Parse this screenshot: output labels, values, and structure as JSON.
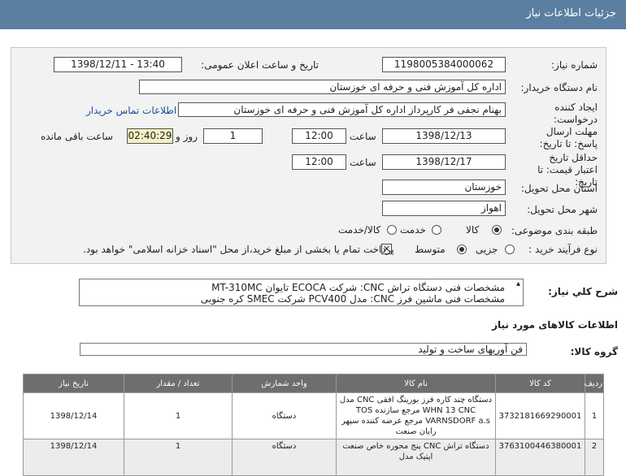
{
  "header": {
    "title": "جزئیات اطلاعات نیاز"
  },
  "fields": {
    "need_number_label": "شماره نیاز:",
    "need_number": "1198005384000062",
    "announce_label": "تاریخ و ساعت اعلان عمومی:",
    "announce_value": "1398/12/11 - 13:40",
    "buyer_label": "نام دستگاه خریدار:",
    "buyer_value": "اداره کل آموزش فنی و حرفه ای خوزستان",
    "creator_label": "ایجاد کننده درخواست:",
    "creator_value": "بهنام  نجفی فر  کارپرداز اداره کل آموزش فنی و حرفه ای خوزستان",
    "contact_link": "اطلاعات تماس خریدار",
    "deadline_label": "مهلت ارسال پاسخ: تا تاریخ:",
    "deadline_date": "1398/12/13",
    "time_label": "ساعت",
    "deadline_time": "12:00",
    "days_value": "1",
    "days_label": "روز و",
    "remaining_value": "02:40:29",
    "remaining_label": "ساعت باقی مانده",
    "validity_label": "حداقل تاریخ اعتبار قیمت: تا تاریخ:",
    "validity_date": "1398/12/17",
    "validity_time": "12:00",
    "province_label": "استان محل تحویل:",
    "province_value": "خوزستان",
    "city_label": "شهر محل تحویل:",
    "city_value": "اهواز",
    "category_label": "طبقه بندی موضوعی:",
    "category_options": [
      "کالا",
      "خدمت",
      "کالا/خدمت"
    ],
    "process_label": "نوع فرآیند خرید :",
    "process_options": [
      "جزیی",
      "متوسط"
    ],
    "payment_note": "پرداخت تمام یا بخشی از مبلغ خرید،از محل \"اسناد خزانه اسلامی\" خواهد بود."
  },
  "summary": {
    "label": "شرح کلي نياز:",
    "line1": "مشخصات فنی دستگاه تراش CNC: شرکت ECOCA تایوان MT-310MC",
    "line2": "مشخصات فنی ماشین فرز CNC: مدل PCV400 شرکت SMEC کره جنوبی"
  },
  "goods": {
    "section_title": "اطلاعات کالاهای مورد نیاز",
    "group_label": "گروه کالا:",
    "group_value": "فن آوریهای ساخت و تولید"
  },
  "table": {
    "headers": [
      "ردیف",
      "کد کالا",
      "نام کالا",
      "واحد شمارش",
      "تعداد / مقدار",
      "تاریخ نیاز"
    ],
    "rows": [
      [
        "1",
        "3732181669290001",
        "دستگاه چند کاره فرز بورینگ افقی CNC مدل WHN 13 CNC مرجع سازنده TOS VARNSDORF a.s مرجع عرضه کننده سپهر رایان صنعت",
        "دستگاه",
        "1",
        "1398/12/14"
      ],
      [
        "2",
        "3763100446380001",
        "دستگاه تراش CNC پنج محوره خاص صنعت اپتیک مدل",
        "دستگاه",
        "1",
        "1398/12/14"
      ]
    ]
  }
}
